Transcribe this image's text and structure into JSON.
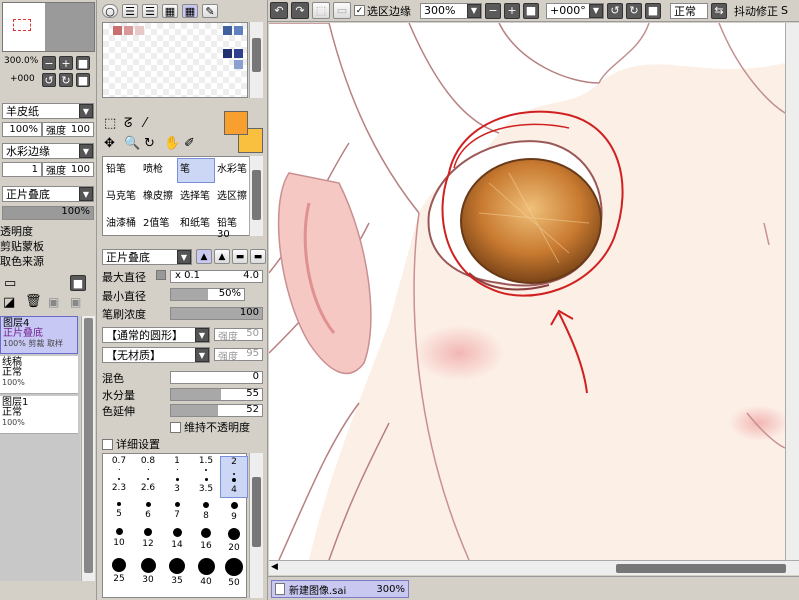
{
  "navigator": {
    "zoom": "300.0%",
    "angle": "+000"
  },
  "left": {
    "texture_label": "羊皮纸",
    "texture_percent": "100%",
    "texture_strength_label": "强度",
    "texture_strength": "100",
    "edge_label": "水彩边缘",
    "edge_value": "1",
    "edge_strength_label": "强度",
    "edge_strength": "100",
    "blend_label": "正片叠底",
    "opacity": "100%",
    "opts": [
      "透明度",
      "剪贴蒙板",
      "取色来源"
    ],
    "layers": [
      {
        "name": "图层4",
        "mode": "正片叠底",
        "extra": "100% 剪裁 取样"
      },
      {
        "name": "线稿",
        "mode": "正常",
        "extra": "100%"
      },
      {
        "name": "图层1",
        "mode": "正常",
        "extra": "100%"
      }
    ]
  },
  "tools": {
    "grid": [
      [
        "铅笔",
        "喷枪",
        "笔",
        "水彩笔"
      ],
      [
        "马克笔",
        "橡皮擦",
        "选择笔",
        "选区擦"
      ],
      [
        "油漆桶",
        "2值笔",
        "和纸笔",
        "铅笔30"
      ]
    ],
    "selected": "笔",
    "colors": {
      "primary": "#f7a030",
      "secondary": "#f9c040"
    }
  },
  "brush": {
    "blend": "正片叠底",
    "max_diam_label": "最大直径",
    "max_mult": "x 0.1",
    "max_val": "4.0",
    "min_diam_label": "最小直径",
    "min_val": "50%",
    "density_label": "笔刷浓度",
    "density_val": "100",
    "shape": "【通常的圆形】",
    "shape_strength_label": "强度",
    "shape_strength": "50",
    "material": "【无材质】",
    "material_strength_label": "强度",
    "material_strength": "95",
    "mix_label": "混色",
    "mix_val": "0",
    "water_label": "水分量",
    "water_val": "55",
    "extend_label": "色延伸",
    "extend_val": "52",
    "keep_opacity": "维持不透明度",
    "detail": "详细设置",
    "size_rows": [
      [
        "0.7",
        "0.8",
        "1",
        "1.5",
        "2"
      ],
      [
        "2.3",
        "2.6",
        "3",
        "3.5",
        "4"
      ],
      [
        "5",
        "6",
        "7",
        "8",
        "9"
      ],
      [
        "10",
        "12",
        "14",
        "16",
        "20"
      ],
      [
        "25",
        "30",
        "35",
        "40",
        "50"
      ]
    ]
  },
  "toolbar": {
    "sel_edge": "选区边缘",
    "zoom": "300%",
    "angle": "+000°",
    "mode": "正常",
    "stabilizer": "抖动修正",
    "stab_value": "S"
  },
  "status": {
    "filename": "新建图像.sai",
    "zoom": "300%"
  }
}
